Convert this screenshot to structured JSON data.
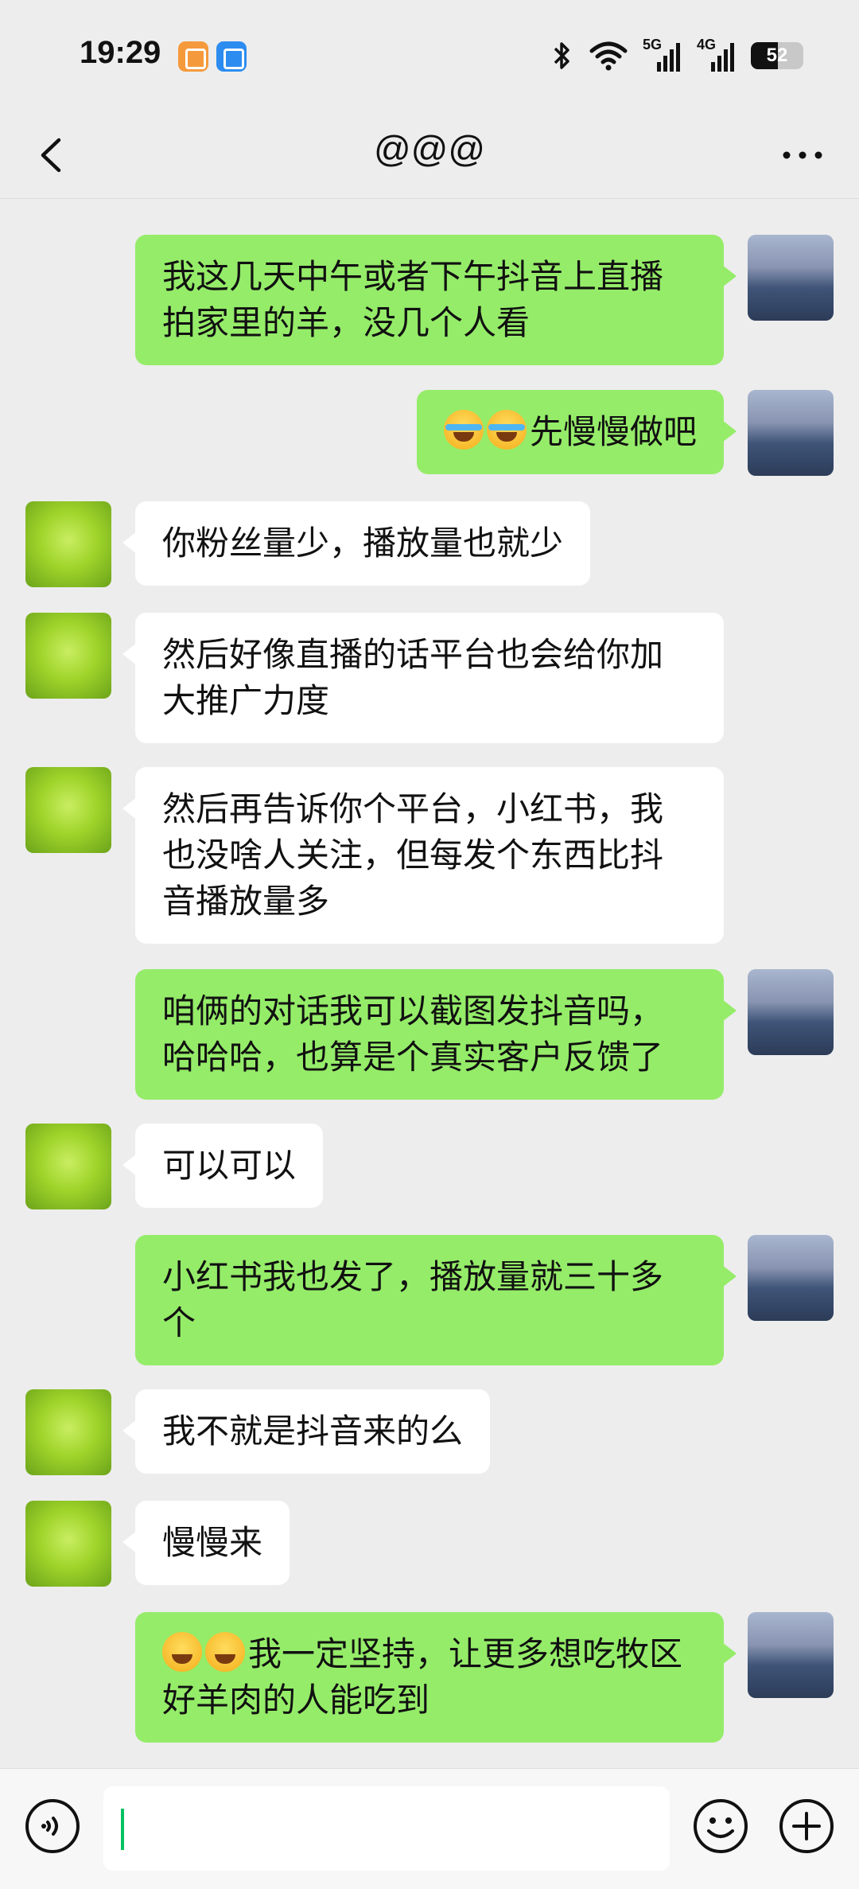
{
  "status_bar": {
    "time": "19:29",
    "signal_5g": "5G",
    "signal_4g": "4G",
    "battery": "52",
    "battery_level": 0.52
  },
  "nav": {
    "title": "@@@",
    "back_icon": "chevron-left-icon",
    "more_icon": "more-horizontal-icon"
  },
  "messages": [
    {
      "side": "self",
      "text": "我这几天中午或者下午抖音上直播\n拍家里的羊，没几个人看"
    },
    {
      "side": "self",
      "emojis": [
        "face-with-tears-of-joy-icon",
        "face-with-tears-of-joy-icon"
      ],
      "text": "先慢慢做吧"
    },
    {
      "side": "other",
      "text": "你粉丝量少，播放量也就少"
    },
    {
      "side": "other",
      "text": "然后好像直播的话平台也会给你加\n大推广力度"
    },
    {
      "side": "other",
      "text": "然后再告诉你个平台，小红书，我\n也没啥人关注，但每发个东西比抖\n音播放量多"
    },
    {
      "side": "self",
      "text": "咱俩的对话我可以截图发抖音吗，\n哈哈哈，也算是个真实客户反馈了"
    },
    {
      "side": "other",
      "text": "可以可以"
    },
    {
      "side": "self",
      "text": "小红书我也发了，播放量就三十多\n个"
    },
    {
      "side": "other",
      "text": "我不就是抖音来的么"
    },
    {
      "side": "other",
      "text": "慢慢来"
    },
    {
      "side": "self",
      "emojis": [
        "grinning-face-icon",
        "grinning-face-icon"
      ],
      "text": "我一定坚持，让更多想吃牧区\n好羊肉的人能吃到"
    }
  ],
  "input_bar": {
    "text_value": "",
    "voice_icon": "voice-icon",
    "emoji_icon": "emoji-icon",
    "plus_icon": "plus-icon"
  },
  "colors": {
    "self_bubble": "#95ec69",
    "other_bubble": "#ffffff",
    "background": "#ededed",
    "caret": "#07c160"
  }
}
